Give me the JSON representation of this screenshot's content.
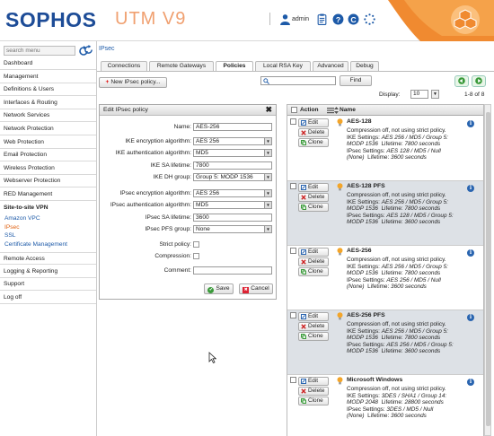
{
  "header": {
    "logo": "SOPHOS",
    "product": "UTM V9",
    "user": "admin",
    "colors": {
      "brand_blue": "#1d4c97",
      "accent_orange": "#f08a30"
    },
    "icons": [
      "user-icon",
      "clipboard-icon",
      "help-icon",
      "copyright-icon",
      "spinner-icon"
    ]
  },
  "sidebar": {
    "search_placeholder": "search menu",
    "items": [
      "Dashboard",
      "Management",
      "Definitions & Users",
      "Interfaces & Routing",
      "Network Services",
      "Network Protection",
      "Web Protection",
      "Email Protection",
      "Wireless Protection",
      "Webserver Protection",
      "RED Management",
      "Site-to-site VPN"
    ],
    "sub_items": [
      "Amazon VPC",
      "IPsec",
      "SSL",
      "Certificate Management"
    ],
    "active_sub": "IPsec",
    "items_after": [
      "Remote Access",
      "Logging & Reporting",
      "Support",
      "Log off"
    ]
  },
  "page_title": "IPsec",
  "tabs": [
    "Connections",
    "Remote Gateways",
    "Policies",
    "Local RSA Key",
    "Advanced",
    "Debug"
  ],
  "active_tab": "Policies",
  "toolbar": {
    "new_button": "New IPsec policy...",
    "find_button": "Find",
    "display_label": "Display:",
    "display_value": "10",
    "range": "1-8 of 8"
  },
  "edit_form": {
    "title": "Edit IPsec policy",
    "fields": {
      "name_label": "Name:",
      "name_value": "AES-256",
      "ike_enc_label": "IKE encryption algorithm:",
      "ike_enc_value": "AES 256",
      "ike_auth_label": "IKE authentication algorithm:",
      "ike_auth_value": "MD5",
      "ike_sa_label": "IKE SA lifetime:",
      "ike_sa_value": "7800",
      "ike_dh_label": "IKE DH group:",
      "ike_dh_value": "Group 5: MODP 1536",
      "ipsec_enc_label": "IPsec encryption algorithm:",
      "ipsec_enc_value": "AES 256",
      "ipsec_auth_label": "IPsec authentication algorithm:",
      "ipsec_auth_value": "MD5",
      "ipsec_sa_label": "IPsec SA lifetime:",
      "ipsec_sa_value": "3600",
      "ipsec_pfs_label": "IPsec PFS group:",
      "ipsec_pfs_value": "None",
      "strict_label": "Strict policy:",
      "compression_label": "Compression:",
      "comment_label": "Comment:",
      "comment_value": ""
    },
    "save": "Save",
    "cancel": "Cancel"
  },
  "list": {
    "col_action": "Action",
    "col_name": "Name",
    "btn_edit": "Edit",
    "btn_delete": "Delete",
    "btn_clone": "Clone",
    "policies": [
      {
        "name": "AES-128",
        "line1": "Compression off, not using strict policy.",
        "ike_prefix": "IKE Settings: ",
        "ike": "AES 256 / MD5 / Group 5: MODP 1536",
        "ike_life_prefix": "Lifetime: ",
        "ike_life": "7800 seconds",
        "ipsec_prefix": "IPsec Settings: ",
        "ipsec": "AES 128 / MD5 / Null (None)",
        "ipsec_life_prefix": "Lifetime: ",
        "ipsec_life": "3600 seconds"
      },
      {
        "name": "AES-128 PFS",
        "line1": "Compression off, not using strict policy.",
        "ike_prefix": "IKE Settings: ",
        "ike": "AES 256 / MD5 / Group 5: MODP 1536",
        "ike_life_prefix": "Lifetime: ",
        "ike_life": "7800 seconds",
        "ipsec_prefix": "IPsec Settings: ",
        "ipsec": "AES 128 / MD5 / Group 5: MODP 1536",
        "ipsec_life_prefix": "Lifetime: ",
        "ipsec_life": "3600 seconds"
      },
      {
        "name": "AES-256",
        "line1": "Compression off, not using strict policy.",
        "ike_prefix": "IKE Settings: ",
        "ike": "AES 256 / MD5 / Group 5: MODP 1536",
        "ike_life_prefix": "Lifetime: ",
        "ike_life": "7800 seconds",
        "ipsec_prefix": "IPsec Settings: ",
        "ipsec": "AES 256 / MD5 / Null (None)",
        "ipsec_life_prefix": "Lifetime: ",
        "ipsec_life": "3600 seconds"
      },
      {
        "name": "AES-256 PFS",
        "line1": "Compression off, not using strict policy.",
        "ike_prefix": "IKE Settings: ",
        "ike": "AES 256 / MD5 / Group 5: MODP 1536",
        "ike_life_prefix": "Lifetime: ",
        "ike_life": "7800 seconds",
        "ipsec_prefix": "IPsec Settings: ",
        "ipsec": "AES 256 / MD5 / Group 5: MODP 1536",
        "ipsec_life_prefix": "Lifetime: ",
        "ipsec_life": "3600 seconds"
      },
      {
        "name": "Microsoft Windows",
        "line1": "Compression off, not using strict policy.",
        "ike_prefix": "IKE Settings: ",
        "ike": "3DES / SHA1 / Group 14: MODP 2048",
        "ike_life_prefix": "Lifetime: ",
        "ike_life": "28800 seconds",
        "ipsec_prefix": "IPsec Settings: ",
        "ipsec": "3DES / MD5 / Null (None)",
        "ipsec_life_prefix": "Lifetime: ",
        "ipsec_life": "3600 seconds"
      }
    ]
  }
}
